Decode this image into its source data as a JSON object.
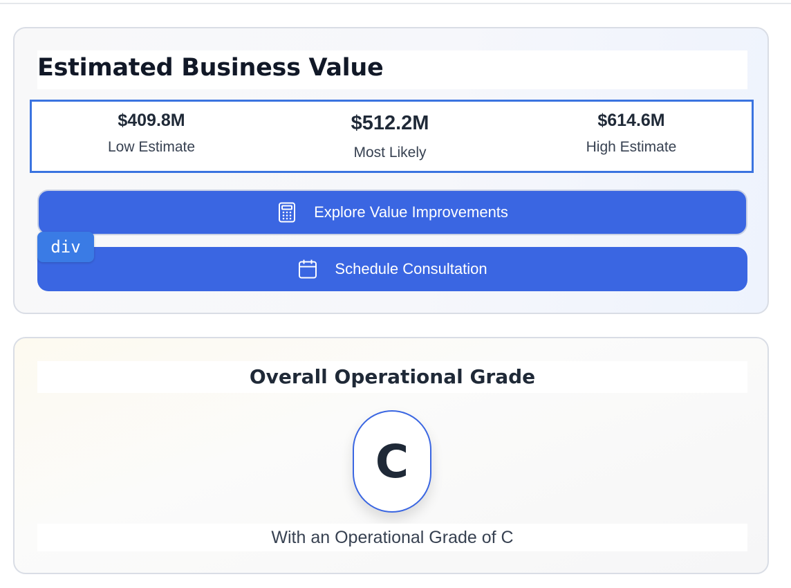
{
  "value_card": {
    "title": "Estimated Business Value",
    "estimates": {
      "low": {
        "value": "$409.8M",
        "label": "Low Estimate"
      },
      "most_likely": {
        "value": "$512.2M",
        "label": "Most Likely"
      },
      "high": {
        "value": "$614.6M",
        "label": "High Estimate"
      }
    },
    "buttons": {
      "explore": {
        "label": "Explore Value Improvements",
        "icon": "calculator-icon"
      },
      "schedule": {
        "label": "Schedule Consultation",
        "icon": "calendar-icon"
      }
    },
    "inspector_tag": "div"
  },
  "grade_card": {
    "title": "Overall Operational Grade",
    "grade": "C",
    "caption": "With an Operational Grade of C"
  },
  "colors": {
    "accent": "#3a66e2",
    "highlight_border": "#3a73e0",
    "text_dark": "#111827",
    "text_muted": "#374151"
  }
}
